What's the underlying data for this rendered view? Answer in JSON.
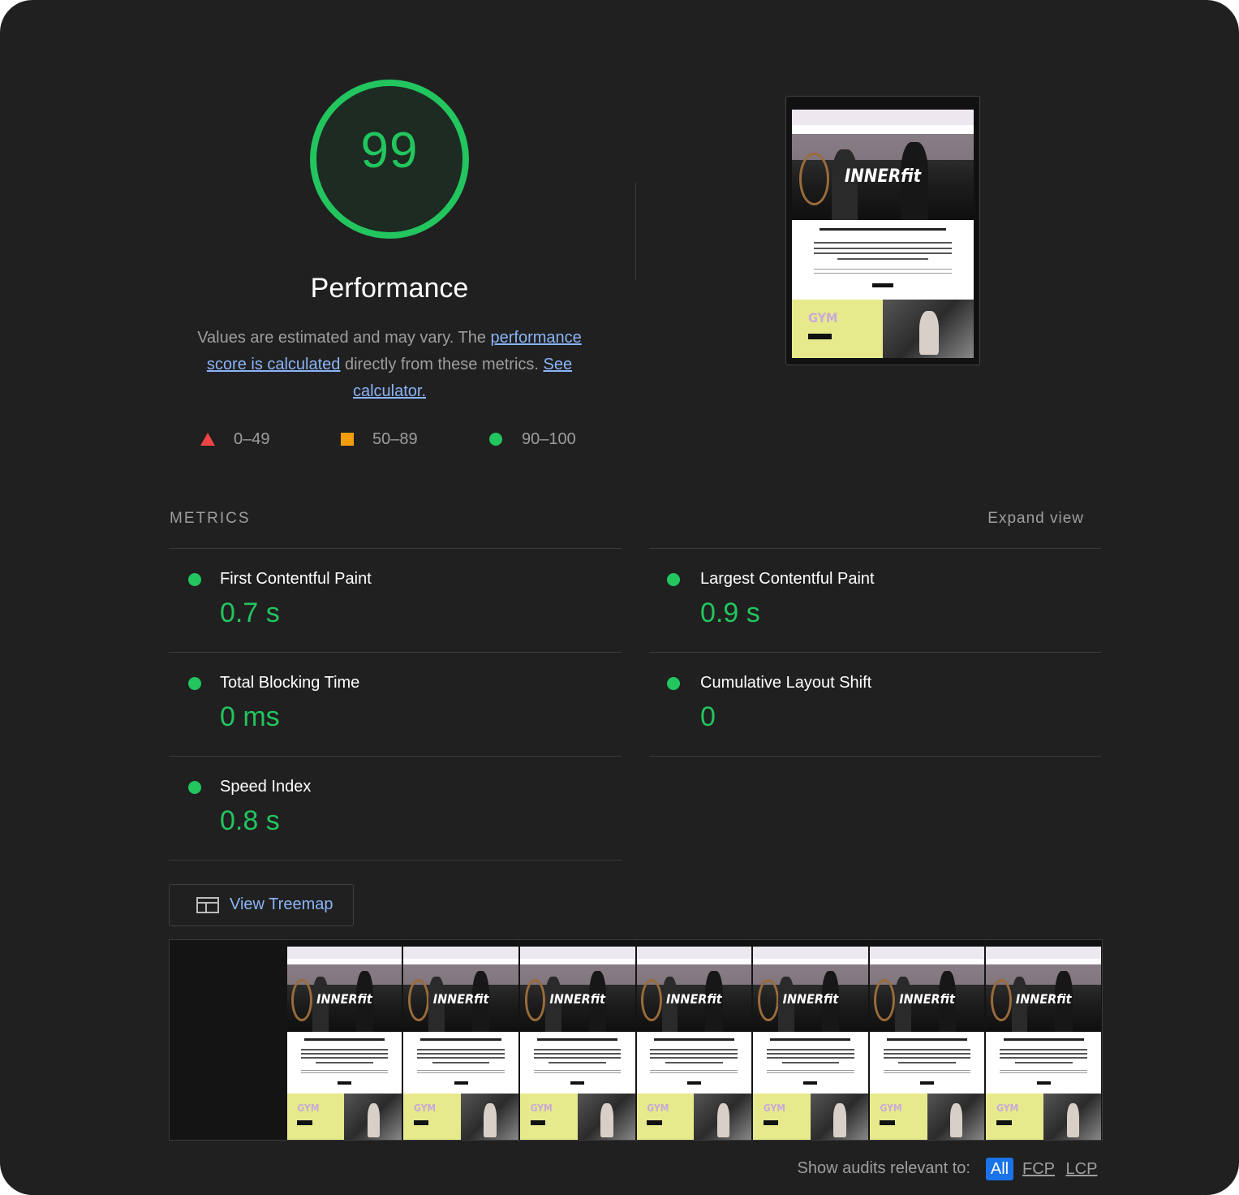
{
  "category": {
    "score": "99",
    "title": "Performance",
    "score_color": "#22c55e"
  },
  "description": {
    "text_1": "Values are estimated and may vary. The ",
    "link_1": "performance score is calculated",
    "text_2": " directly from these metrics. ",
    "link_2": "See calculator."
  },
  "legend": [
    {
      "range": "0–49",
      "shape": "triangle",
      "color": "#ef4444"
    },
    {
      "range": "50–89",
      "shape": "square",
      "color": "#f59e0b"
    },
    {
      "range": "90–100",
      "shape": "circle",
      "color": "#22c55e"
    }
  ],
  "final_screenshot": {
    "logo": "INNERfit"
  },
  "metrics": {
    "section_title": "METRICS",
    "expand_label": "Expand view",
    "items": [
      {
        "label": "First Contentful Paint",
        "value": "0.7 s"
      },
      {
        "label": "Largest Contentful Paint",
        "value": "0.9 s"
      },
      {
        "label": "Total Blocking Time",
        "value": "0 ms"
      },
      {
        "label": "Cumulative Layout Shift",
        "value": "0"
      },
      {
        "label": "Speed Index",
        "value": "0.8 s"
      }
    ]
  },
  "treemap": {
    "label": "View Treemap",
    "icon": "treemap-icon"
  },
  "filmstrip": {
    "frame_count": 8,
    "blank_frames": 1
  },
  "audit_filter": {
    "label": "Show audits relevant to:",
    "options": [
      "All",
      "FCP",
      "LCP"
    ],
    "selected": "All"
  }
}
